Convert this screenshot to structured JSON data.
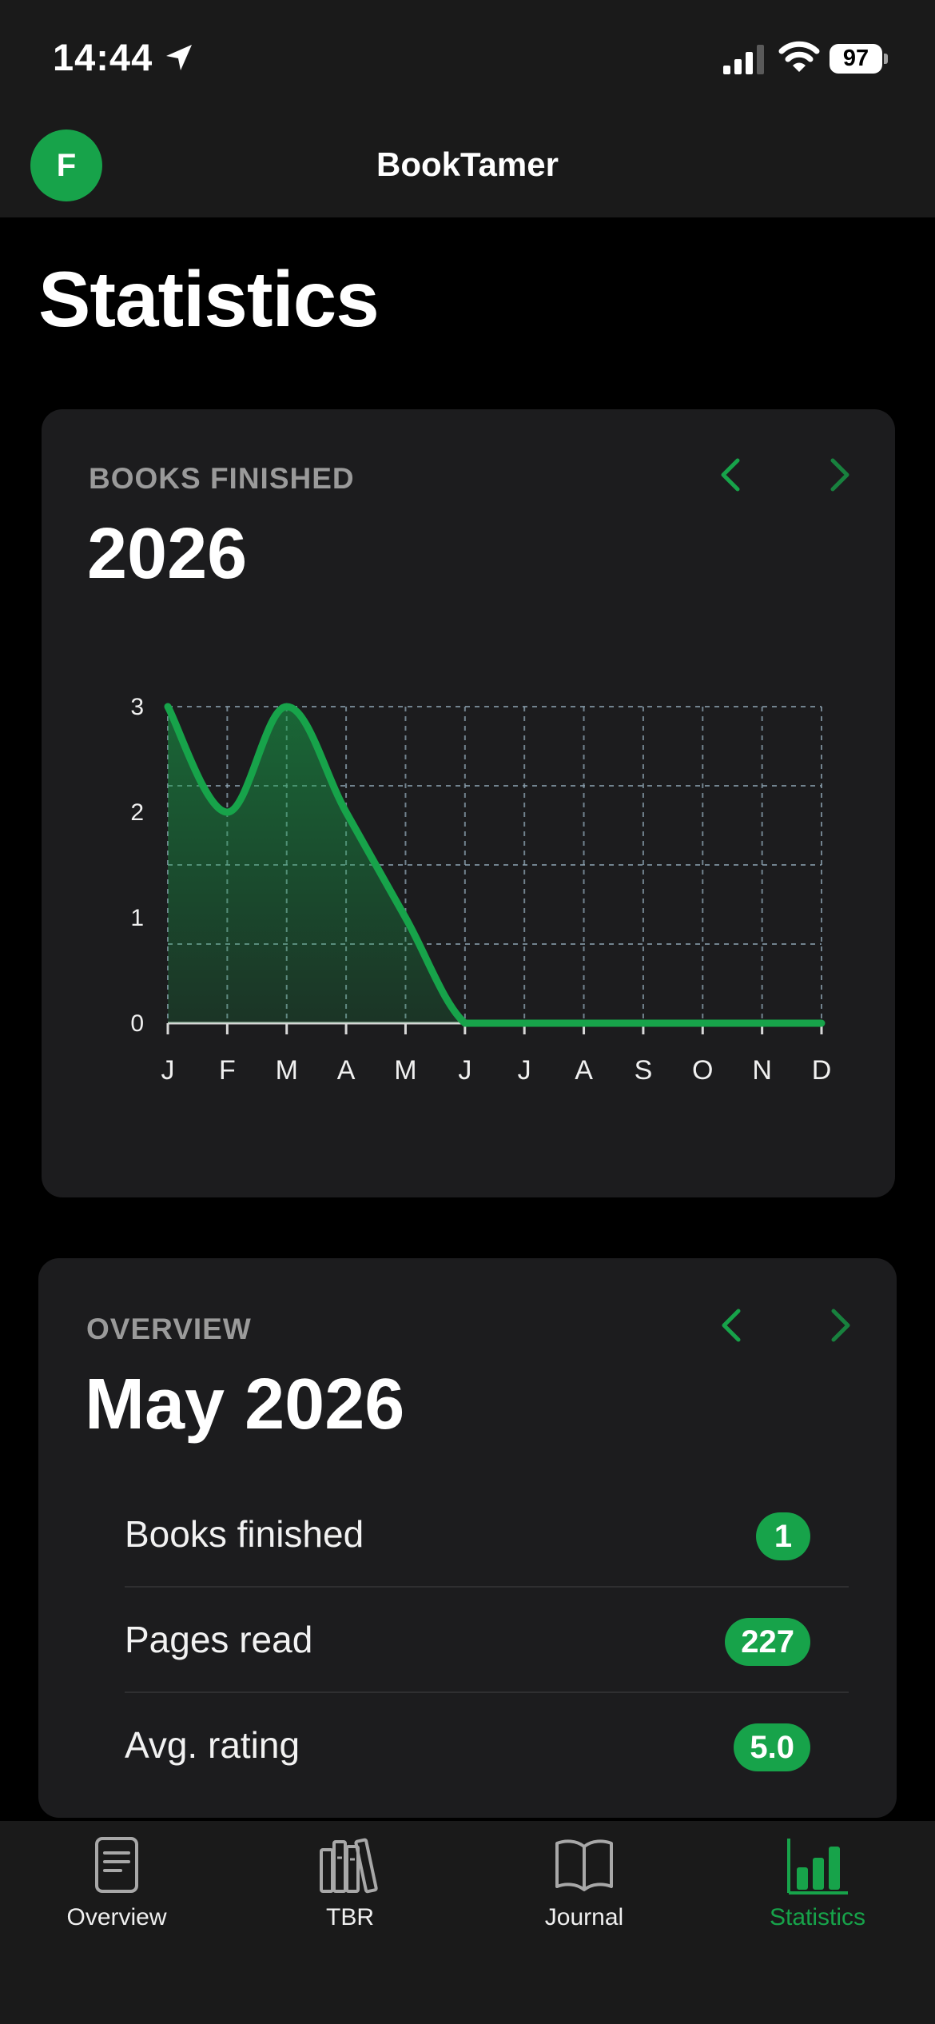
{
  "status_bar": {
    "time": "14:44",
    "battery": "97"
  },
  "header": {
    "avatar_initial": "F",
    "title": "BookTamer"
  },
  "page": {
    "title": "Statistics"
  },
  "books_card": {
    "label": "BOOKS FINISHED",
    "year": "2026"
  },
  "chart_data": {
    "type": "area",
    "categories": [
      "J",
      "F",
      "M",
      "A",
      "M",
      "J",
      "J",
      "A",
      "S",
      "O",
      "N",
      "D"
    ],
    "values": [
      3,
      2,
      3,
      2,
      1,
      0,
      0,
      0,
      0,
      0,
      0,
      0
    ],
    "y_ticks": [
      "0",
      "1",
      "2",
      "3"
    ],
    "ylim": [
      0,
      3
    ],
    "grid": true,
    "title": "",
    "xlabel": "",
    "ylabel": "",
    "line_color": "#17a34a",
    "grid_color": "#8fa6b5"
  },
  "overview": {
    "label": "OVERVIEW",
    "period": "May 2026",
    "rows": [
      {
        "label": "Books finished",
        "value": "1"
      },
      {
        "label": "Pages read",
        "value": "227"
      },
      {
        "label": "Avg. rating",
        "value": "5.0"
      }
    ]
  },
  "tabs": [
    {
      "label": "Overview",
      "icon": "document-icon",
      "active": false
    },
    {
      "label": "TBR",
      "icon": "bookshelf-icon",
      "active": false
    },
    {
      "label": "Journal",
      "icon": "open-book-icon",
      "active": false
    },
    {
      "label": "Statistics",
      "icon": "bar-chart-icon",
      "active": true
    }
  ],
  "colors": {
    "accent": "#17a34a",
    "background": "#000000",
    "card": "#1c1c1e",
    "bar": "#1a1a1a"
  }
}
